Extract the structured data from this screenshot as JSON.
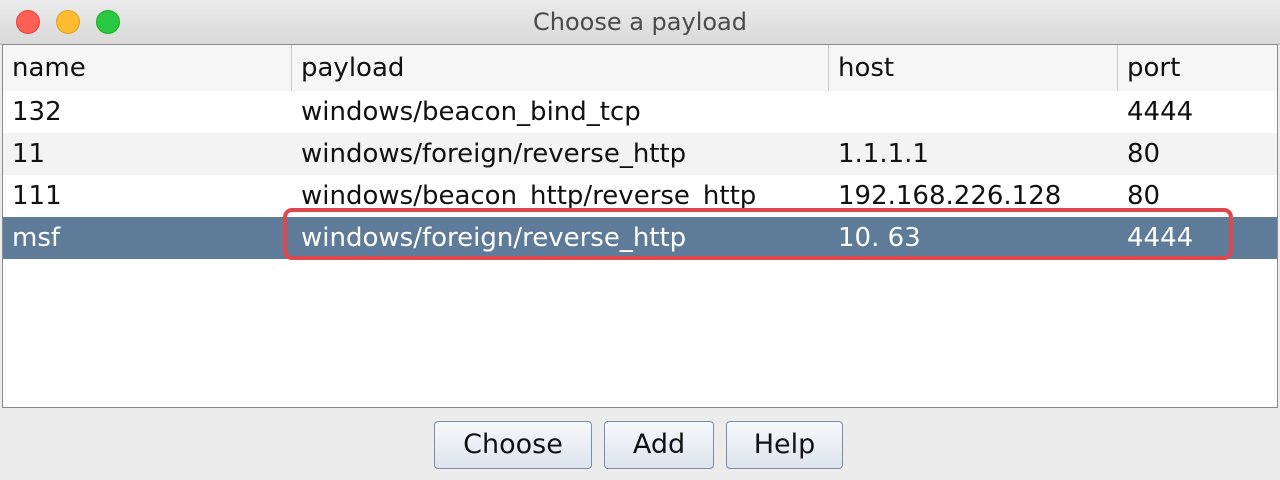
{
  "window": {
    "title": "Choose a payload"
  },
  "table": {
    "columns": [
      "name",
      "payload",
      "host",
      "port"
    ],
    "rows": [
      {
        "name": "132",
        "payload": "windows/beacon_bind_tcp",
        "host": "",
        "port": "4444"
      },
      {
        "name": "11",
        "payload": "windows/foreign/reverse_http",
        "host": "1.1.1.1",
        "port": "80"
      },
      {
        "name": "111",
        "payload": "windows/beacon_http/reverse_http",
        "host": "192.168.226.128",
        "port": "80"
      },
      {
        "name": "msf",
        "payload": "windows/foreign/reverse_http",
        "host": "10.  63",
        "port": "4444"
      }
    ],
    "selected_row": 3
  },
  "buttons": {
    "choose": "Choose",
    "add": "Add",
    "help": "Help"
  },
  "colors": {
    "selection": "#5e7b9a",
    "highlight_box": "#e0474c"
  }
}
